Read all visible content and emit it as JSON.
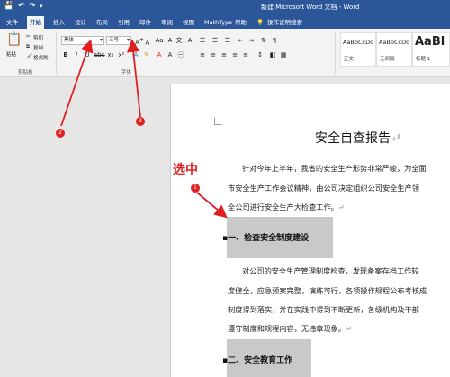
{
  "window": {
    "title": "新建 Microsoft Word 文档 - Word",
    "quick_access": {
      "save_icon": "save-icon",
      "undo_icon": "undo-icon",
      "redo_icon": "redo-icon",
      "customize_icon": "chevron-down-icon"
    }
  },
  "tabs": [
    "文件",
    "开始",
    "插入",
    "设计",
    "布局",
    "引用",
    "邮件",
    "审阅",
    "视图",
    "MathType",
    "帮助",
    "操作说明搜索"
  ],
  "active_tab": "开始",
  "ribbon": {
    "clipboard": {
      "paste": "粘贴",
      "cut": "剪切",
      "copy": "复制",
      "format_painter": "格式刷",
      "group_label": "剪贴板"
    },
    "font": {
      "font_name": "黑体",
      "font_size": "三号",
      "group_label": "字体"
    },
    "styles": [
      {
        "preview": "AaBbCcDd",
        "name": "正文"
      },
      {
        "preview": "AaBbCcDd",
        "name": "无间隔"
      },
      {
        "preview": "AaBl",
        "name": "标题 1"
      }
    ]
  },
  "document": {
    "title": "安全自查报告",
    "paragraphs": [
      "针对今年上半年，我省的安全生产形势非常严峻，为全面",
      "市安全生产工作会议精神，由公司决定组织公司安全生产领",
      "全公司进行安全生产大检查工作。"
    ],
    "heading1": "一、检查安全制度建设",
    "paragraphs2": [
      "对公司的安全生产管理制度检查，发现备案存档工作较",
      "度健全，应急预案完整，演练可行，各项操作规程公布考核成",
      "制度得到落实，并在实践中得到不断更新，各级机构及干部",
      "遵守制度和规程内容，无违章现象。"
    ],
    "heading2": "二、安全教育工作"
  },
  "annotations": {
    "select_label": "选中",
    "badges": [
      "1",
      "2",
      "3"
    ]
  },
  "colors": {
    "brand": "#2b579a",
    "annotation": "#e02020",
    "selection": "#c9c9c9"
  }
}
